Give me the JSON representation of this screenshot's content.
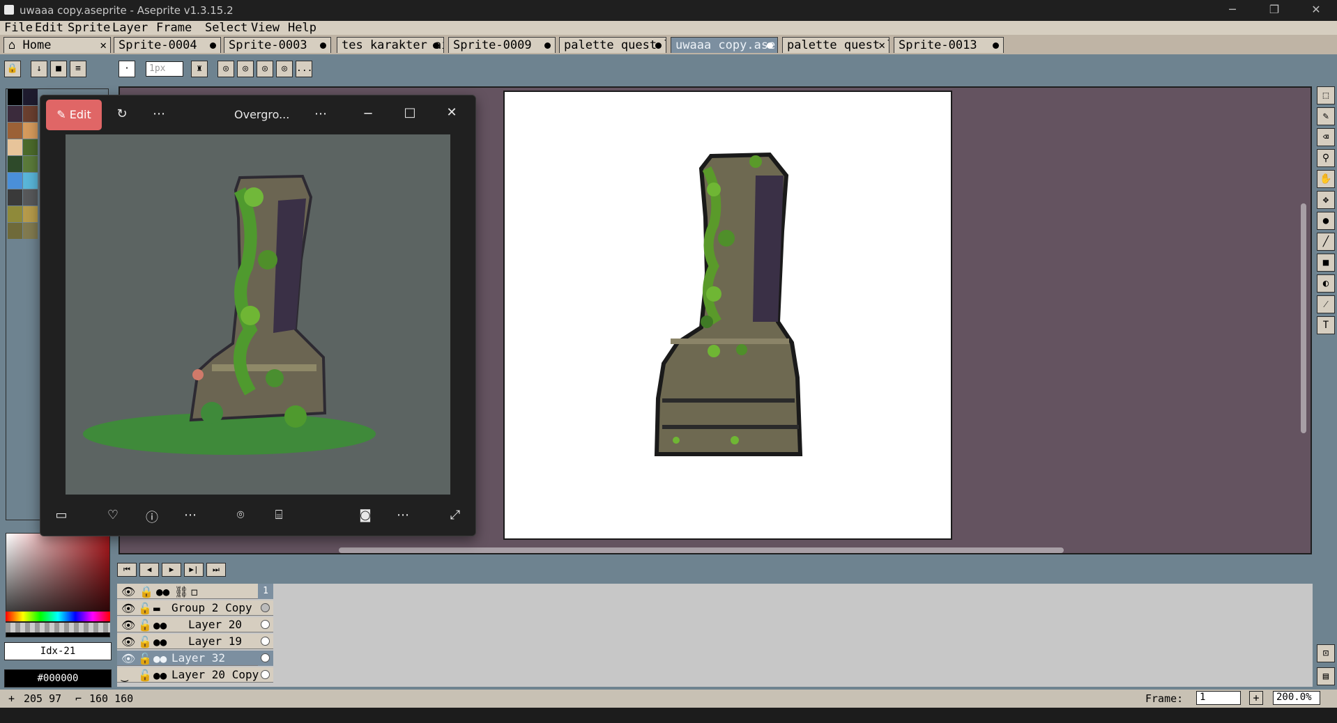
{
  "window": {
    "title": "uwaaa copy.aseprite - Aseprite v1.3.15.2",
    "controls": [
      "─",
      "❐",
      "✕"
    ]
  },
  "menu": [
    "File",
    "Edit",
    "Sprite",
    "Layer",
    "Frame",
    "Select",
    "View",
    "Help"
  ],
  "tabs": [
    {
      "label": "Home",
      "icon": "home-icon",
      "close": "✕"
    },
    {
      "label": "Sprite-0004"
    },
    {
      "label": "Sprite-0003"
    },
    {
      "label": "tes karakter ai"
    },
    {
      "label": "Sprite-0009"
    },
    {
      "label": "palette quest lc"
    },
    {
      "label": "uwaaa copy.ase",
      "active": true
    },
    {
      "label": "palette quest lc",
      "close": "✕"
    },
    {
      "label": "Sprite-0013"
    }
  ],
  "toolbar": {
    "brush_size": "1px",
    "more": "..."
  },
  "viewer": {
    "edit_label": "Edit",
    "title": "Overgro...",
    "more": "⋯"
  },
  "layers": {
    "frame_header": "1",
    "rows": [
      {
        "name": "Group 2 Copy",
        "group": true
      },
      {
        "name": "Layer 20"
      },
      {
        "name": "Layer 19"
      },
      {
        "name": "Layer 32",
        "selected": true
      },
      {
        "name": "Layer 20 Copy"
      }
    ]
  },
  "color_panel": {
    "index_label": "Idx-21",
    "hex_label": "#000000"
  },
  "status": {
    "cursor": "205 97",
    "size": "160 160",
    "frame_label": "Frame:",
    "frame_value": "1",
    "zoom": "200.0%"
  },
  "palette_colors": [
    "#000000",
    "#1e1b2e",
    "#3b2b3c",
    "#6a3f2f",
    "#9b6137",
    "#d59a5c",
    "#e7c49a",
    "#4b6a2b",
    "#2e4a2a",
    "#5a7a3a",
    "#4a8fd8",
    "#59b5d8",
    "#3a3a3a",
    "#57585a",
    "#8f8a3a",
    "#b59a4a",
    "#6f6a3a",
    "#817a4f"
  ],
  "colors": {
    "accent_active_tab": "#7c8fa0",
    "canvas_bg": "#645360",
    "edit_button": "#e06666"
  }
}
